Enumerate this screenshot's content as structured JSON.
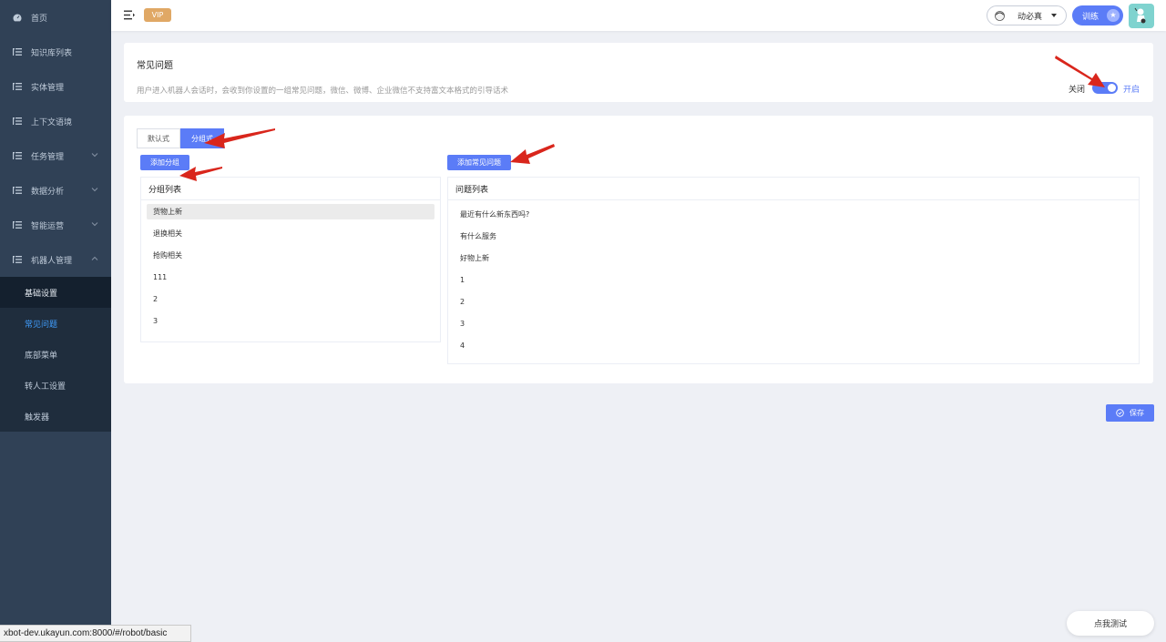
{
  "sidebar": {
    "items": [
      {
        "label": "首页",
        "icon": "dashboard-icon",
        "has_chevron": false
      },
      {
        "label": "知识库列表",
        "icon": "list-icon",
        "has_chevron": false
      },
      {
        "label": "实体管理",
        "icon": "list-icon",
        "has_chevron": false
      },
      {
        "label": "上下文语境",
        "icon": "list-icon",
        "has_chevron": false
      },
      {
        "label": "任务管理",
        "icon": "list-icon",
        "has_chevron": true
      },
      {
        "label": "数据分析",
        "icon": "list-icon",
        "has_chevron": true
      },
      {
        "label": "智能运营",
        "icon": "list-icon",
        "has_chevron": true
      },
      {
        "label": "机器人管理",
        "icon": "list-icon",
        "has_chevron": true
      }
    ],
    "submenu": [
      {
        "label": "基础设置"
      },
      {
        "label": "常见问题",
        "active": true
      },
      {
        "label": "底部菜单"
      },
      {
        "label": "转人工设置"
      },
      {
        "label": "触发器"
      }
    ]
  },
  "header": {
    "vip_badge": "VIP",
    "user_name": "动必真",
    "train_label": "训练"
  },
  "faq": {
    "title": "常见问题",
    "description": "用户进入机器人会话时，会收到你设置的一组常见问题，微信、微博、企业微信不支持富文本格式的引导话术",
    "switch_off_label": "关闭",
    "switch_on_label": "开启",
    "switch_enabled": true
  },
  "mode_tabs": [
    "默认式",
    "分组式"
  ],
  "active_tab": "分组式",
  "group_panel": {
    "add_button": "添加分组",
    "header": "分组列表",
    "rows": [
      "货物上新",
      "退换相关",
      "抢购相关",
      "111",
      "2",
      "3"
    ],
    "selected": "货物上新"
  },
  "question_panel": {
    "add_button": "添加常见问题",
    "header": "问题列表",
    "rows": [
      "最近有什么新东西吗?",
      "有什么服务",
      "好物上新",
      "1",
      "2",
      "3",
      "4"
    ]
  },
  "save_label": "保存",
  "test_label": "点我测试",
  "status_url": "xbot-dev.ukayun.com:8000/#/robot/basic",
  "colors": {
    "sidebar_bg": "#304156",
    "submenu_bg": "#1f2d3d",
    "primary": "#5b7cf7",
    "vip": "#e0a865",
    "annotation_arrow": "#d9261c"
  }
}
